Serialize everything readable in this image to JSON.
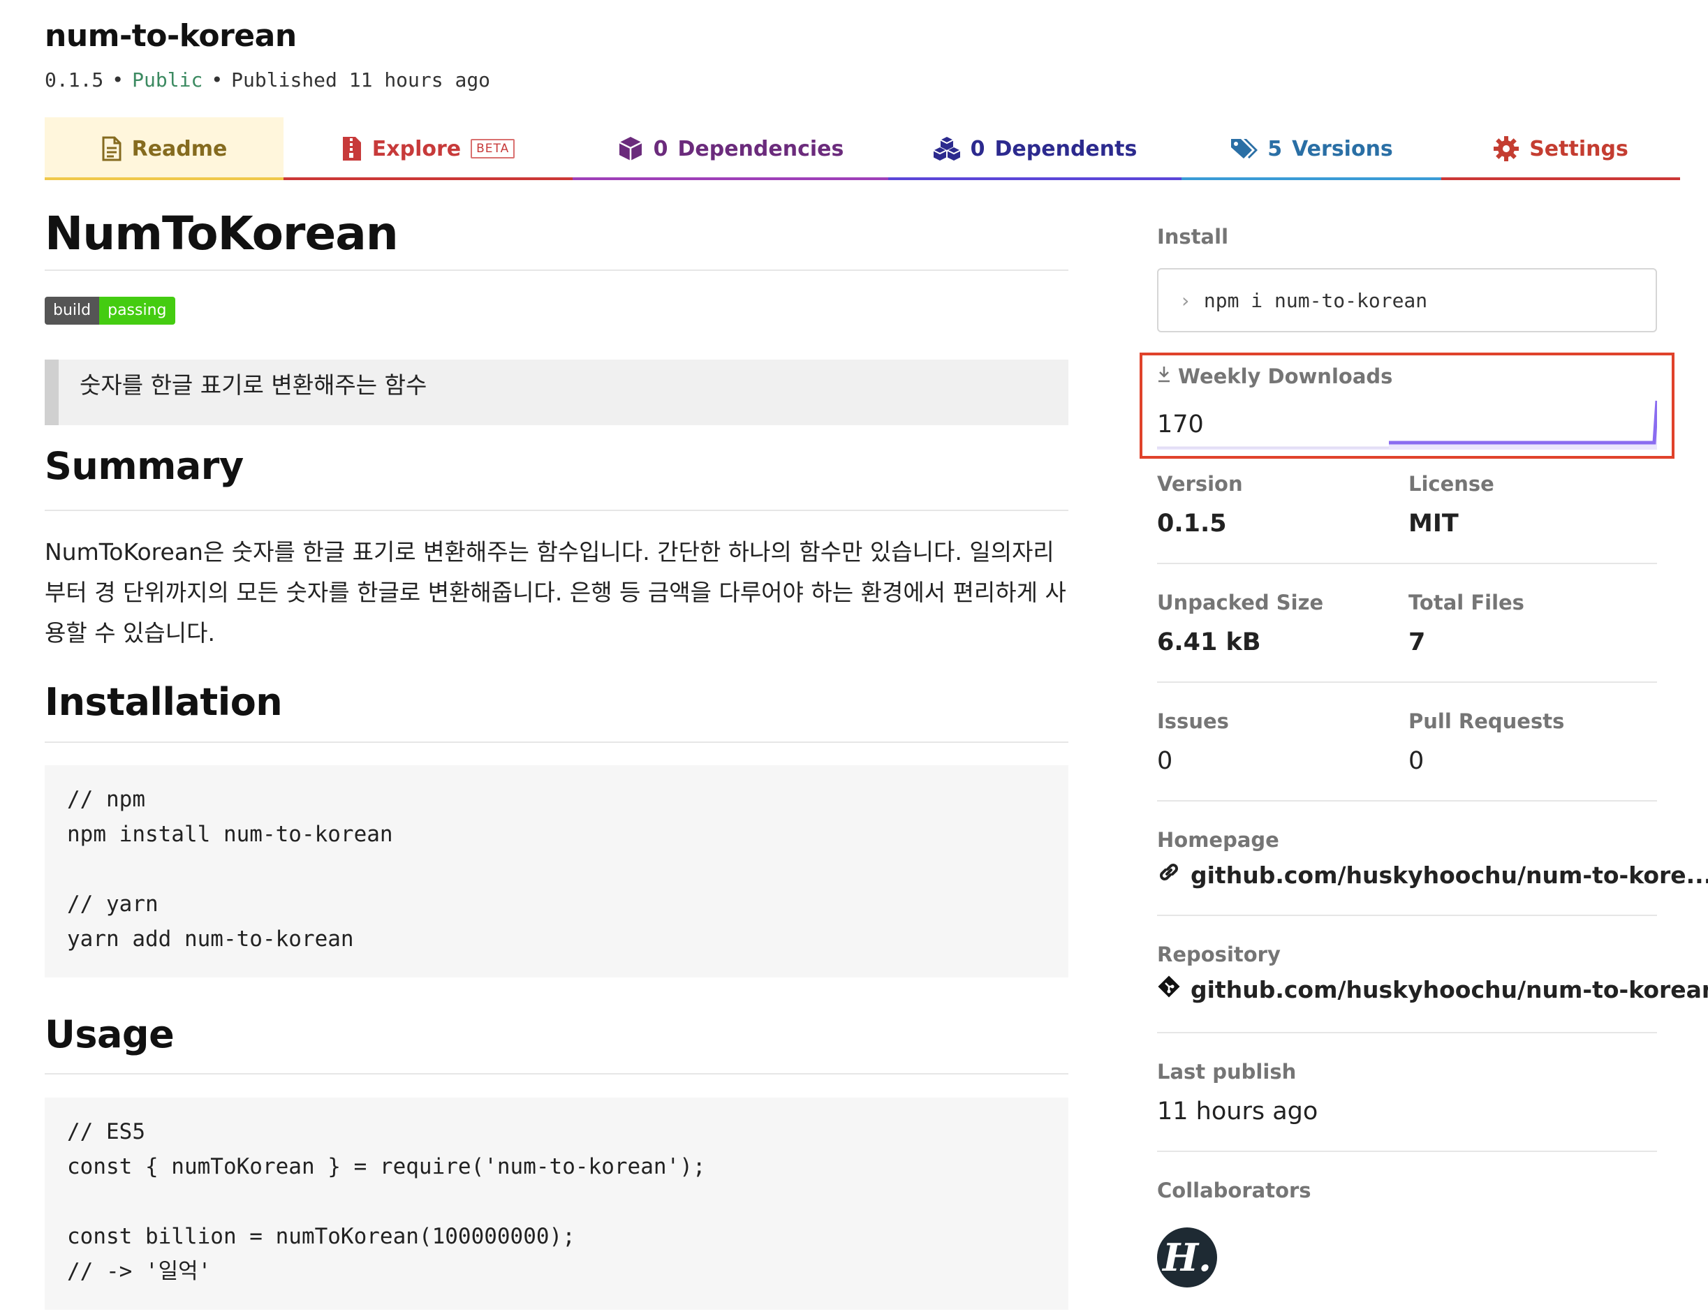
{
  "package": {
    "name": "num-to-korean",
    "version": "0.1.5",
    "visibility": "Public",
    "published": "Published 11 hours ago"
  },
  "tabs": {
    "readme": {
      "label": "Readme",
      "icon": "readme-icon",
      "color": "#856b1f"
    },
    "explore": {
      "label": "Explore",
      "badge": "BETA",
      "icon": "explore-zip-icon",
      "color": "#c73a3a"
    },
    "dependencies": {
      "count": "0",
      "label": "Dependencies",
      "icon": "box-icon",
      "color": "#6b2b7c"
    },
    "dependents": {
      "count": "0",
      "label": "Dependents",
      "icon": "boxes-icon",
      "color": "#2c2a8e"
    },
    "versions": {
      "count": "5",
      "label": "Versions",
      "icon": "tags-icon",
      "color": "#2a6fa5"
    },
    "settings": {
      "label": "Settings",
      "icon": "gear-icon",
      "color": "#c43d31"
    }
  },
  "readme": {
    "title": "NumToKorean",
    "badge": {
      "left": "build",
      "right": "passing"
    },
    "quote": "숫자를 한글 표기로 변환해주는 함수",
    "summary_heading": "Summary",
    "summary_text": "NumToKorean은 숫자를 한글 표기로 변환해주는 함수입니다. 간단한 하나의 함수만 있습니다. 일의자리부터 경 단위까지의 모든 숫자를 한글로 변환해줍니다. 은행 등 금액을 다루어야 하는 환경에서 편리하게 사용할 수 있습니다.",
    "installation_heading": "Installation",
    "installation_code": "// npm\nnpm install num-to-korean\n\n// yarn\nyarn add num-to-korean",
    "usage_heading": "Usage",
    "usage_code": "// ES5\nconst { numToKorean } = require('num-to-korean');\n\nconst billion = numToKorean(100000000);\n// -> '일억'"
  },
  "sidebar": {
    "install_label": "Install",
    "install_command": "npm i num-to-korean",
    "weekly_downloads_label": "Weekly Downloads",
    "weekly_downloads_value": "170",
    "version_label": "Version",
    "version_value": "0.1.5",
    "license_label": "License",
    "license_value": "MIT",
    "unpacked_size_label": "Unpacked Size",
    "unpacked_size_value": "6.41 kB",
    "total_files_label": "Total Files",
    "total_files_value": "7",
    "issues_label": "Issues",
    "issues_value": "0",
    "pull_requests_label": "Pull Requests",
    "pull_requests_value": "0",
    "homepage_label": "Homepage",
    "homepage_value": "github.com/huskyhoochu/num-to-kore...",
    "repository_label": "Repository",
    "repository_value": "github.com/huskyhoochu/num-to-korean",
    "last_publish_label": "Last publish",
    "last_publish_value": "11 hours ago",
    "collaborators_label": "Collaborators",
    "collaborator_initial": "H."
  },
  "colors": {
    "highlight_border": "#e0422b",
    "sparkline": "#8a6cf0",
    "badge_passing": "#44cc11"
  }
}
